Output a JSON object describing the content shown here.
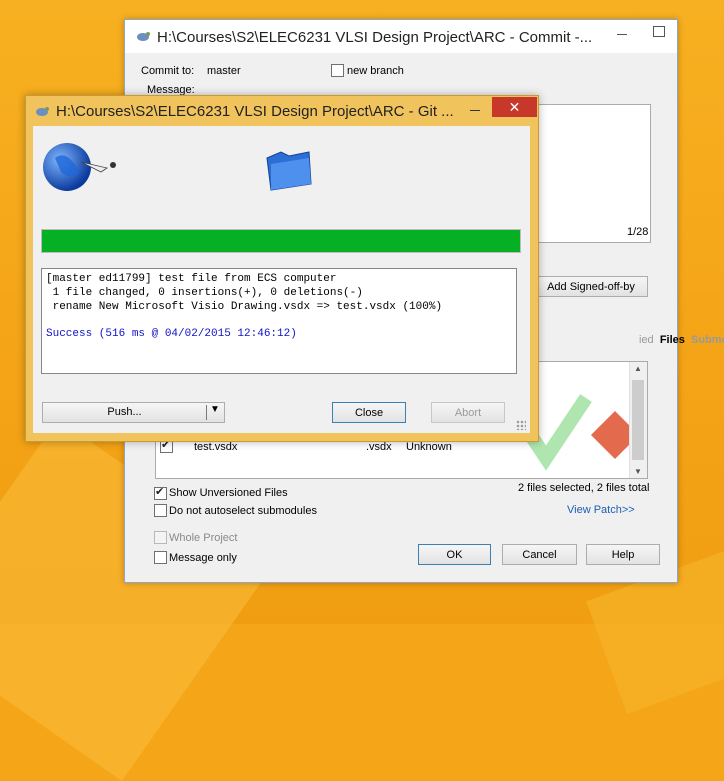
{
  "commit_window": {
    "title": "H:\\Courses\\S2\\ELEC6231 VLSI Design Project\\ARC - Commit -...",
    "commit_to_label": "Commit to:",
    "branch": "master",
    "new_branch_label": "new branch",
    "message_label": "Message:",
    "char_count": "1/28",
    "add_signed_off_label": "Add Signed-off-by",
    "tabs": [
      "ied",
      "Files",
      "Submodules"
    ],
    "file_row": {
      "name": "test.vsdx",
      "ext": ".vsdx",
      "status": "Unknown"
    },
    "show_unversioned_label": "Show Unversioned Files",
    "show_unversioned_checked": true,
    "no_autoselect_label": "Do not autoselect submodules",
    "files_selected_text": "2 files selected, 2 files total",
    "view_patch_label": "View Patch>>",
    "whole_project_label": "Whole Project",
    "message_only_label": "Message only",
    "ok_label": "OK",
    "cancel_label": "Cancel",
    "help_label": "Help"
  },
  "progress_window": {
    "title": "H:\\Courses\\S2\\ELEC6231 VLSI Design Project\\ARC - Git ...",
    "close_glyph": "✕",
    "progress": 1.0,
    "progress_color": "#06b025",
    "log_lines": [
      "[master ed11799] test file from ECS computer",
      " 1 file changed, 0 insertions(+), 0 deletions(-)",
      " rename New Microsoft Visio Drawing.vsdx => test.vsdx (100%)"
    ],
    "success_text": "Success (516 ms @ 04/02/2015 12:46:12)",
    "push_label": "Push...",
    "close_label": "Close",
    "abort_label": "Abort"
  }
}
